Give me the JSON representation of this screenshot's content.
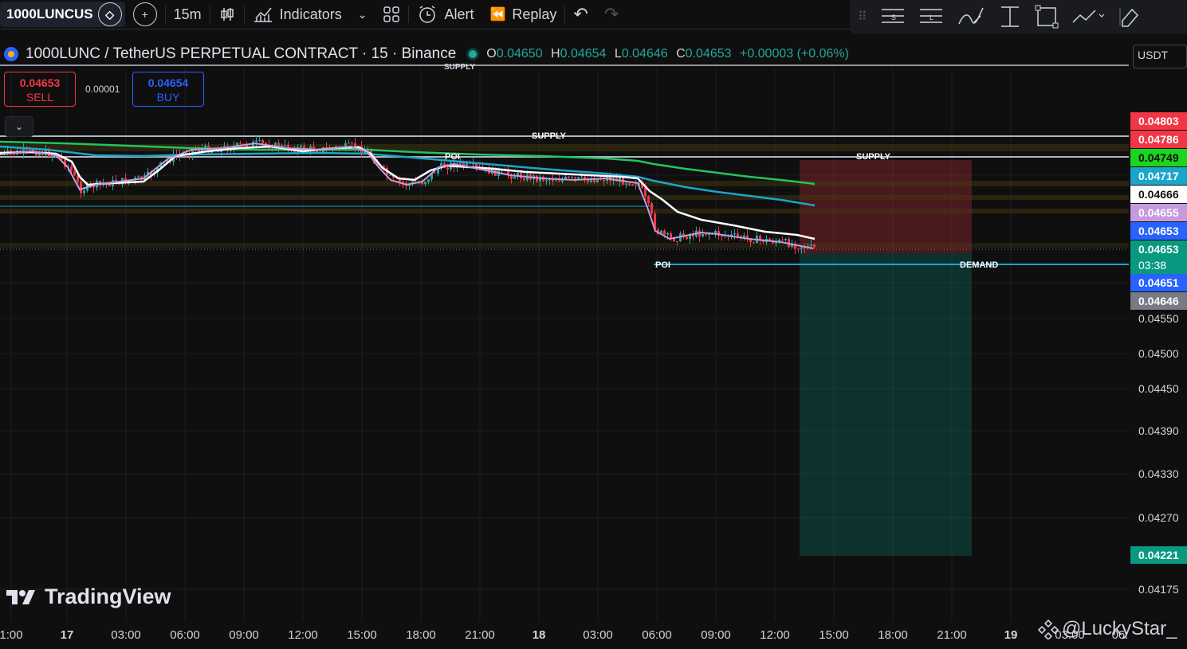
{
  "toolbar": {
    "symbol": "1000LUNCUS",
    "interval": "15m",
    "indicators": "Indicators",
    "alert": "Alert",
    "replay": "Replay"
  },
  "legend": {
    "title": "1000LUNC / TetherUS PERPETUAL CONTRACT · 15 · Binance",
    "o_key": "O",
    "o": "0.04650",
    "h_key": "H",
    "h": "0.04654",
    "l_key": "L",
    "l": "0.04646",
    "c_key": "C",
    "c": "0.04653",
    "change": "+0.00003 (+0.06%)"
  },
  "trade": {
    "sell_price": "0.04653",
    "sell_label": "SELL",
    "spread": "0.00001",
    "buy_price": "0.04654",
    "buy_label": "BUY"
  },
  "currency": "USDT",
  "price_tags": [
    {
      "value": "0.04803",
      "bg": "#f23645",
      "fg": "#ffffff"
    },
    {
      "value": "0.04786",
      "bg": "#f23645",
      "fg": "#ffffff"
    },
    {
      "value": "0.04749",
      "bg": "#1ed51e",
      "fg": "#0f0f10"
    },
    {
      "value": "0.04717",
      "bg": "#1ba6c9",
      "fg": "#ffffff"
    },
    {
      "value": "0.04666",
      "bg": "#ffffff",
      "fg": "#0f0f10"
    },
    {
      "value": "0.04655",
      "bg": "#c59adf",
      "fg": "#ffffff"
    },
    {
      "value": "0.04653",
      "bg": "#2962ff",
      "fg": "#ffffff"
    },
    {
      "value": "0.04653",
      "bg": "#089981",
      "fg": "#ffffff"
    },
    {
      "value": "03:38",
      "bg": "#089981",
      "fg": "#ffffff"
    },
    {
      "value": "0.04651",
      "bg": "#2962ff",
      "fg": "#ffffff"
    },
    {
      "value": "0.04646",
      "bg": "#787b86",
      "fg": "#ffffff"
    },
    {
      "value": "0.04221",
      "bg": "#089981",
      "fg": "#ffffff"
    }
  ],
  "price_axis": [
    "0.04550",
    "0.04500",
    "0.04450",
    "0.04390",
    "0.04330",
    "0.04270",
    "0.04175"
  ],
  "time_axis": [
    "1:00",
    "17",
    "03:00",
    "06:00",
    "09:00",
    "12:00",
    "15:00",
    "18:00",
    "21:00",
    "18",
    "03:00",
    "06:00",
    "09:00",
    "12:00",
    "15:00",
    "18:00",
    "21:00",
    "19",
    "03:00",
    "06:"
  ],
  "chart_labels": {
    "supply_top": "SUPPLY",
    "supply_1": "SUPPLY",
    "supply_2": "SUPPLY",
    "poi_1": "POI",
    "poi_2": "POI",
    "demand": "DEMAND"
  },
  "branding": {
    "logo": "TradingView",
    "watermark": "@LuckyStar_"
  },
  "chart_data": {
    "type": "line",
    "title": "1000LUNC / TetherUS PERPETUAL CONTRACT · 15 · Binance",
    "x": [
      "17 00:00",
      "17 03:00",
      "17 06:00",
      "17 09:00",
      "17 12:00",
      "17 15:00",
      "17 18:00",
      "17 21:00",
      "18 00:00",
      "18 03:00",
      "18 05:00",
      "18 06:00",
      "18 09:00",
      "18 12:00",
      "18 14:00"
    ],
    "series": [
      {
        "name": "",
        "color": "#ffffff",
        "values": [
          0.04755,
          0.04705,
          0.0472,
          0.04762,
          0.04768,
          0.04762,
          0.0472,
          0.04735,
          0.04722,
          0.04715,
          0.04712,
          0.04665,
          0.04668,
          0.0466,
          0.04653
        ]
      },
      {
        "name": "",
        "color": "#22c55e",
        "values": [
          0.04787,
          0.04785,
          0.04782,
          0.0478,
          0.04779,
          0.04776,
          0.04772,
          0.04768,
          0.04764,
          0.0476,
          0.04755,
          0.0475,
          0.04745,
          0.04742,
          0.04741
        ]
      },
      {
        "name": "",
        "color": "#1ba6c9",
        "values": [
          0.0477,
          0.04765,
          0.0476,
          0.04765,
          0.04768,
          0.04762,
          0.0475,
          0.04745,
          0.04738,
          0.0473,
          0.04725,
          0.04712,
          0.047,
          0.0469,
          0.04685
        ]
      }
    ],
    "levels": {
      "supply": [
        0.04803,
        0.04786
      ],
      "demand": 0.0463,
      "current": 0.04653,
      "target": 0.04221
    },
    "position": {
      "entry": 0.04653,
      "stop": 0.0475,
      "target": 0.04221
    },
    "ylim": [
      0.0415,
      0.0482
    ],
    "grid": true,
    "legend": "none"
  }
}
